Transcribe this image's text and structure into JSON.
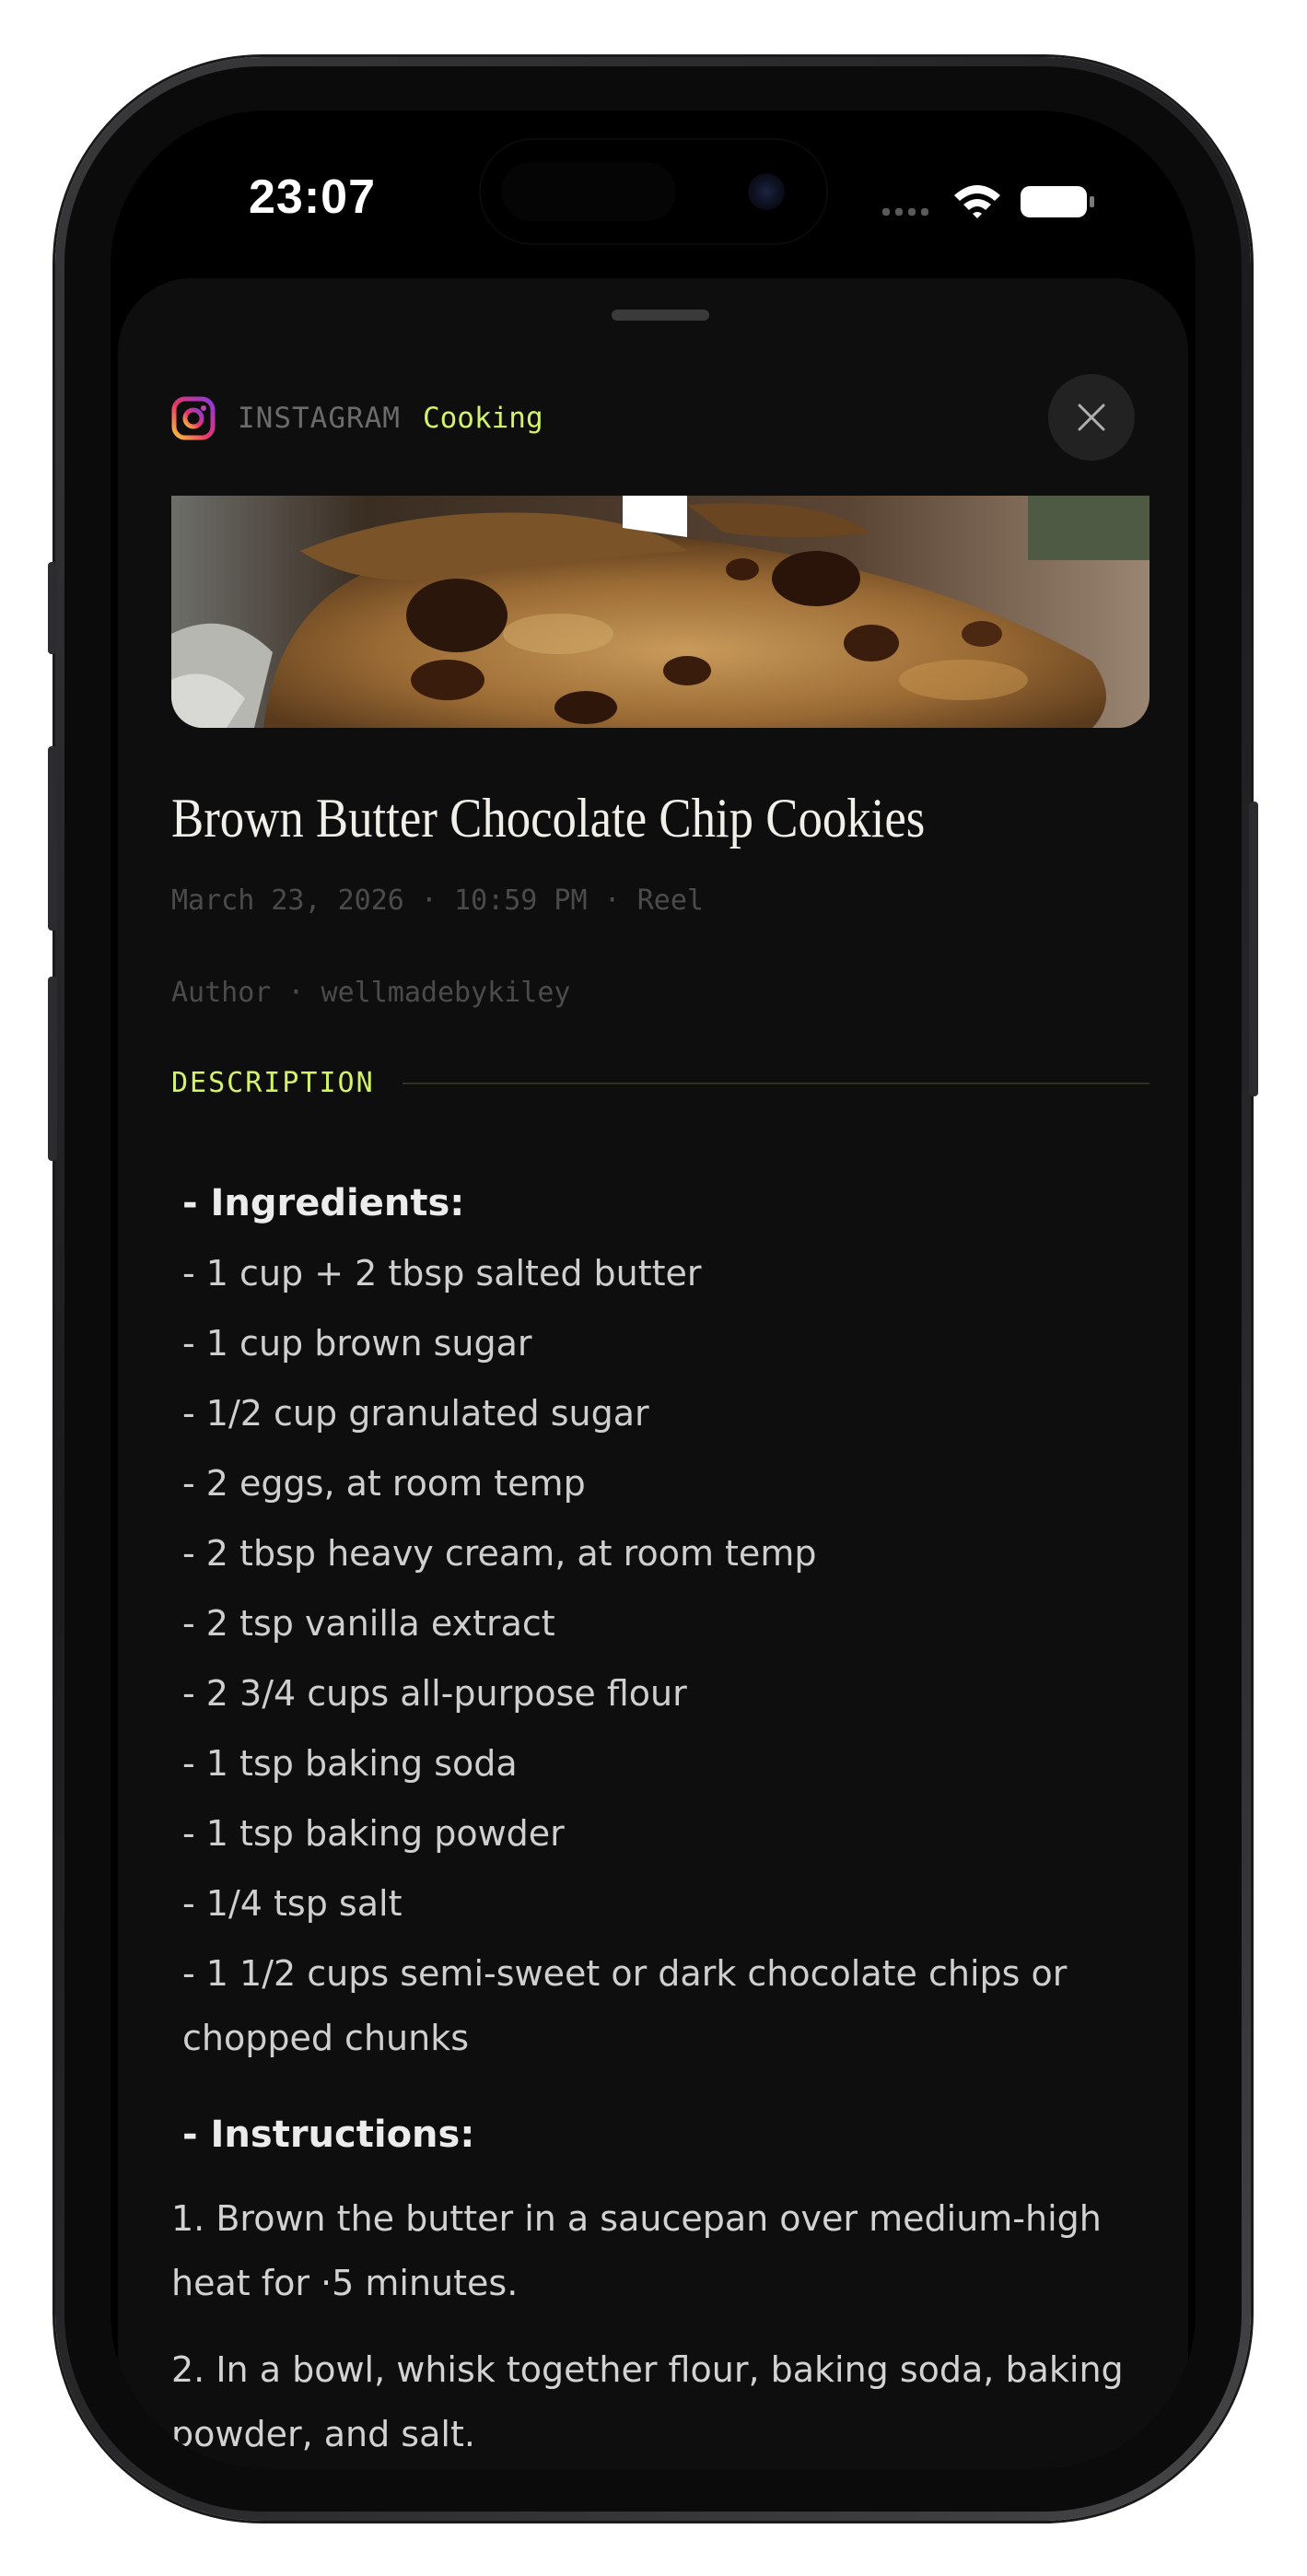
{
  "status_bar": {
    "time": "23:07"
  },
  "sheet": {
    "source": "INSTAGRAM",
    "category": "Cooking",
    "title": "Brown Butter Chocolate Chip Cookies",
    "meta_line": "March 23, 2026 · 10:59 PM · Reel",
    "author_line": "Author · wellmadebykiley",
    "section_label": "DESCRIPTION",
    "ingredients_heading": "- Ingredients:",
    "ingredients": [
      "- 1 cup + 2 tbsp salted butter",
      "- 1 cup brown sugar",
      "- 1/2 cup granulated sugar",
      "- 2 eggs, at room temp",
      "- 2 tbsp heavy cream, at room temp",
      "- 2 tsp vanilla extract",
      "- 2 3/4 cups all-purpose flour",
      "- 1 tsp baking soda",
      "- 1 tsp baking powder",
      "- 1/4 tsp salt",
      "- 1 1/2 cups semi-sweet or dark chocolate chips or chopped chunks"
    ],
    "instructions_heading": "- Instructions:",
    "instructions": [
      "1. Brown the butter in a saucepan over medium-high heat for ·5 minutes.",
      "2. In a bowl, whisk together flour, baking soda, baking powder, and salt."
    ]
  },
  "icons": {
    "source_icon": "instagram-icon",
    "close_icon": "close-icon",
    "signal_icon": "cellular-signal-icon",
    "wifi_icon": "wifi-icon",
    "battery_icon": "battery-icon"
  },
  "colors": {
    "accent": "#d4f26a",
    "sheet_background": "#0e0e0e"
  }
}
